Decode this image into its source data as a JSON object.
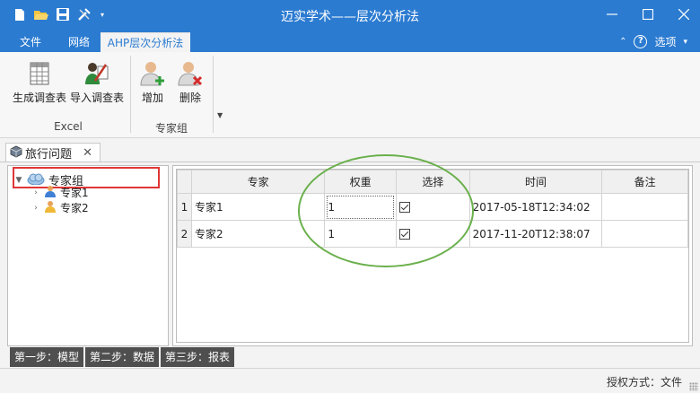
{
  "window": {
    "title": "迈实学术——层次分析法",
    "controls": [
      "minimize",
      "maximize",
      "close"
    ]
  },
  "quick_access": [
    "new-file-icon",
    "open-folder-icon",
    "save-icon",
    "tools-icon",
    "dropdown-icon"
  ],
  "menu_tabs": [
    {
      "label": "文件",
      "active": false
    },
    {
      "label": "网络",
      "active": false
    },
    {
      "label": "AHP层次分析法",
      "active": true
    }
  ],
  "top_right": {
    "options_label": "选项"
  },
  "ribbon": {
    "groups": [
      {
        "label": "Excel",
        "buttons": [
          {
            "label": "生成调查表",
            "icon": "grid-sheet-icon"
          },
          {
            "label": "导入调查表",
            "icon": "import-survey-icon"
          }
        ]
      },
      {
        "label": "专家组",
        "buttons": [
          {
            "label": "增加",
            "icon": "add-user-icon"
          },
          {
            "label": "删除",
            "icon": "remove-user-icon"
          }
        ]
      }
    ]
  },
  "document_tab": {
    "label": "旅行问题"
  },
  "tree": {
    "root": {
      "label": "专家组",
      "icon": "cloud-group-icon"
    },
    "children": [
      {
        "label": "专家1",
        "icon": "expert-user-icon"
      },
      {
        "label": "专家2",
        "icon": "expert-user-icon"
      }
    ]
  },
  "grid": {
    "columns": [
      "专家",
      "权重",
      "选择",
      "时间",
      "备注"
    ],
    "rows": [
      {
        "index": "1",
        "expert": "专家1",
        "weight": "1",
        "selected": true,
        "time": "2017-05-18T12:34:02",
        "note": ""
      },
      {
        "index": "2",
        "expert": "专家2",
        "weight": "1",
        "selected": true,
        "time": "2017-11-20T12:38:07",
        "note": ""
      }
    ]
  },
  "steps": [
    {
      "label": "第一步：模型"
    },
    {
      "label": "第二步：数据"
    },
    {
      "label": "第三步：报表"
    }
  ],
  "status": {
    "text": "授权方式：文件"
  },
  "colors": {
    "title_blue": "#2b7bd1",
    "highlight_red": "#e03636",
    "annotation_green": "#6ab04c",
    "step_tab_dark": "#4f4f4f"
  }
}
